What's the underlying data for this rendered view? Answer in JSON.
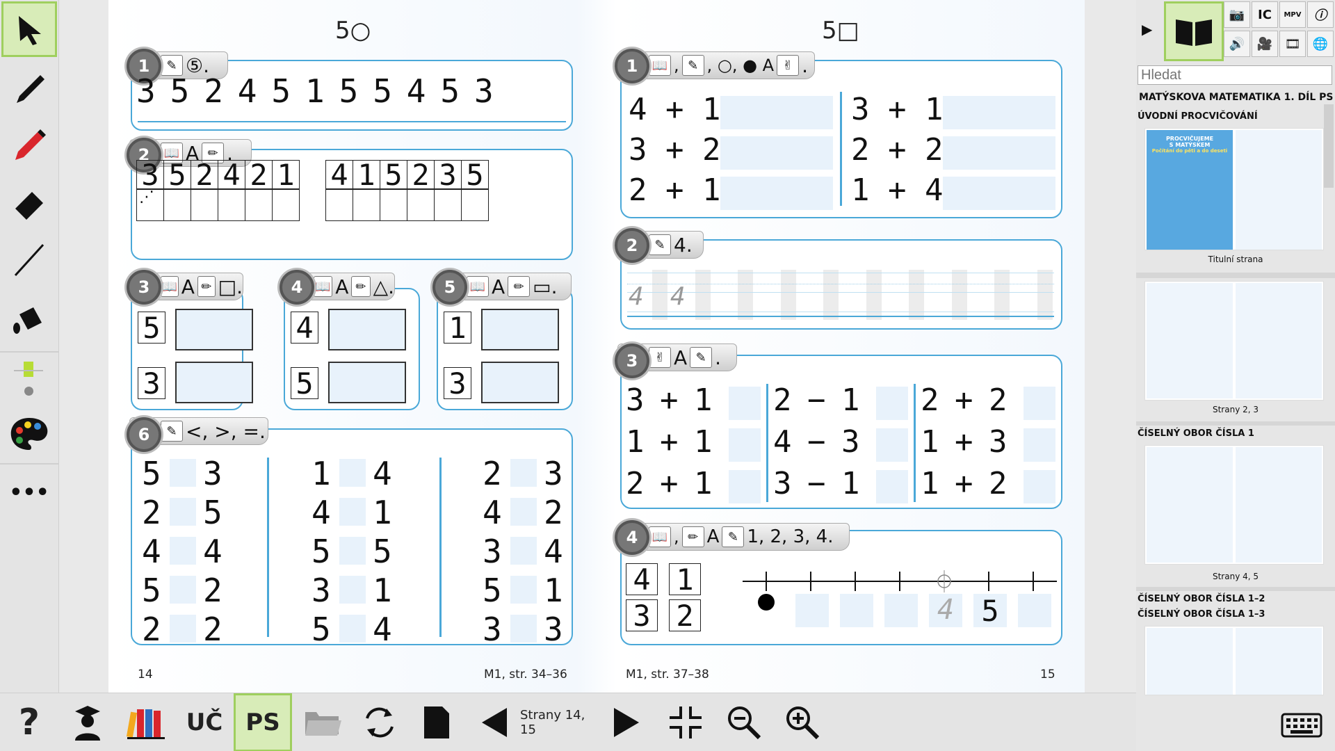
{
  "left_toolbar": {
    "tools": [
      "select-arrow",
      "pencil-black",
      "marker-red",
      "eraser",
      "line",
      "fill-bucket",
      "color-size",
      "palette",
      "more"
    ],
    "more_label": "•••"
  },
  "page": {
    "left_title": "5○",
    "right_title": "5□",
    "left_page_number": "14",
    "left_ref": "M1, str. 34–36",
    "right_ref": "M1, str. 37–38",
    "right_page_number": "15",
    "l1": {
      "num": "1",
      "instr": "⑤.",
      "digits": [
        "3",
        "5",
        "2",
        "4",
        "5",
        "1",
        "5",
        "5",
        "4",
        "5",
        "3"
      ]
    },
    "l2": {
      "num": "2",
      "instr": "A",
      "row1a": [
        "3",
        "5",
        "2",
        "4",
        "2",
        "1"
      ],
      "row1b": [
        "4",
        "1",
        "5",
        "2",
        "3",
        "5"
      ]
    },
    "l3": {
      "num": "3",
      "instr": "A",
      "shape": "□.",
      "a": "5",
      "b": "3"
    },
    "l4": {
      "num": "4",
      "instr": "A",
      "shape": "△.",
      "a": "4",
      "b": "5"
    },
    "l5": {
      "num": "5",
      "instr": "A",
      "shape": "▭.",
      "a": "1",
      "b": "3"
    },
    "l6": {
      "num": "6",
      "instr": "<, >, =.",
      "cols": [
        [
          [
            "5",
            "3"
          ],
          [
            "2",
            "5"
          ],
          [
            "4",
            "4"
          ],
          [
            "5",
            "2"
          ],
          [
            "2",
            "2"
          ]
        ],
        [
          [
            "1",
            "4"
          ],
          [
            "4",
            "1"
          ],
          [
            "5",
            "5"
          ],
          [
            "3",
            "1"
          ],
          [
            "5",
            "4"
          ]
        ],
        [
          [
            "2",
            "3"
          ],
          [
            "4",
            "2"
          ],
          [
            "3",
            "4"
          ],
          [
            "5",
            "1"
          ],
          [
            "3",
            "3"
          ]
        ]
      ]
    },
    "r1": {
      "num": "1",
      "instr": ", ○, ● A",
      "left": [
        "4 + 1",
        "3 + 2",
        "2 + 1"
      ],
      "right": [
        "3 + 1",
        "2 + 2",
        "1 + 4"
      ]
    },
    "r2": {
      "num": "2",
      "instr": "4.",
      "samples": [
        "4",
        "4"
      ]
    },
    "r3": {
      "num": "3",
      "instr": "A",
      "cols": [
        [
          "3 + 1 =",
          "1 + 1 =",
          "2 + 1 ="
        ],
        [
          "2 − 1 =",
          "4 − 3 =",
          "3 − 1 ="
        ],
        [
          "2 + 2 =",
          "1 + 3 =",
          "1 + 2 ="
        ]
      ]
    },
    "r4": {
      "num": "4",
      "instr": "1, 2, 3, 4.",
      "grid": [
        "4",
        "1",
        "3",
        "2"
      ],
      "trace": "4",
      "given": "5"
    }
  },
  "right_panel": {
    "search_placeholder": "Hledat",
    "book_title": "MATÝSKOVA MATEMATIKA 1. DÍL PS",
    "sections": [
      {
        "title": "ÚVODNÍ PROCVIČOVÁNÍ",
        "caption": "Titulní strana"
      },
      {
        "title": "",
        "caption": "Strany 2, 3"
      },
      {
        "title": "ČÍSELNÝ OBOR ČÍSLA 1",
        "caption": "Strany 4, 5"
      },
      {
        "title": "ČÍSELNÝ OBOR ČÍSLA 1–2",
        "title2": "ČÍSELNÝ OBOR ČÍSLA 1–3",
        "caption": ""
      }
    ],
    "cover_text": [
      "PROCVIČUJEME",
      "S MATÝSKEM",
      "Počítání do pěti a do deseti"
    ]
  },
  "bottom": {
    "uc": "UČ",
    "ps": "PS",
    "pages": "Strany 14, 15"
  }
}
